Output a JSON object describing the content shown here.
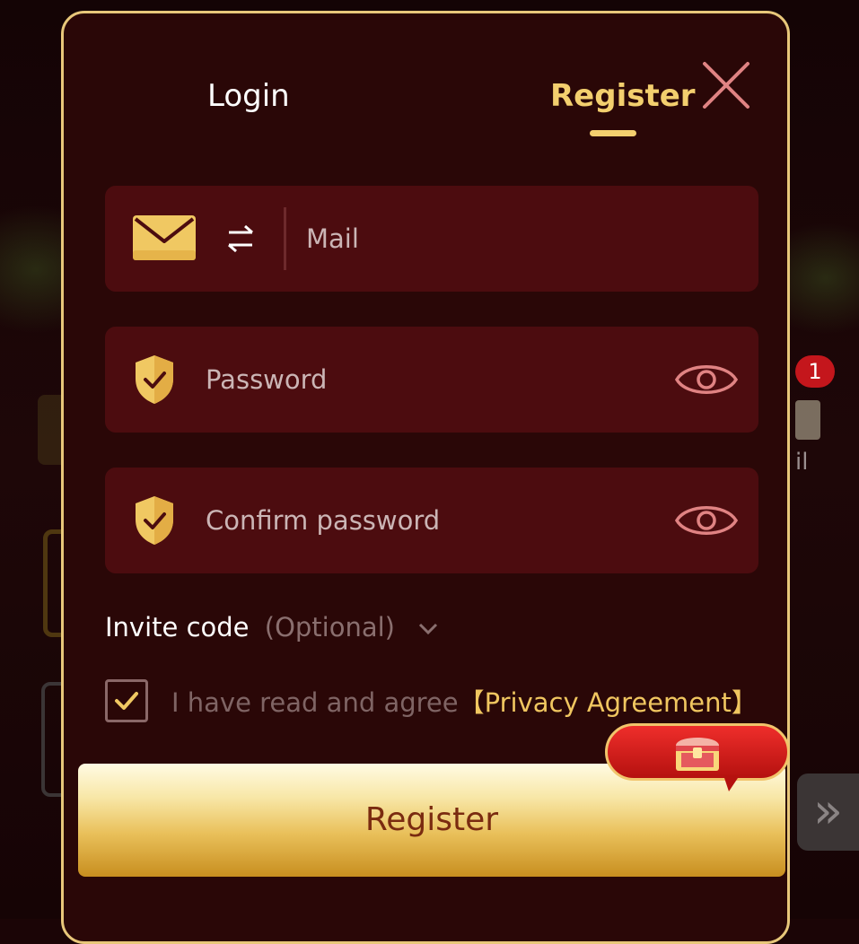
{
  "tabs": {
    "login": "Login",
    "register": "Register",
    "active": "register"
  },
  "fields": {
    "mail_placeholder": "Mail",
    "password_placeholder": "Password",
    "confirm_placeholder": "Confirm password"
  },
  "invite": {
    "label": "Invite code",
    "optional": "(Optional)"
  },
  "agreement": {
    "text": "I have read and agree",
    "link": "【Privacy Agreement】",
    "checked": true
  },
  "submit_label": "Register",
  "background": {
    "badge_count": "1",
    "mail_label": "il"
  },
  "icons": {
    "close": "close-icon",
    "mail": "mail-icon",
    "swap": "swap-icon",
    "shield": "shield-check-icon",
    "eye": "eye-icon",
    "chevron": "chevron-down-icon",
    "gift": "treasure-chest-icon",
    "next": "double-chevron-right-icon"
  },
  "colors": {
    "accent_gold": "#f3cf6e",
    "panel_bg": "#2a0707",
    "field_bg": "#4c0c0f",
    "border_gold": "#e8c77a",
    "button_text": "#7a2b10"
  }
}
